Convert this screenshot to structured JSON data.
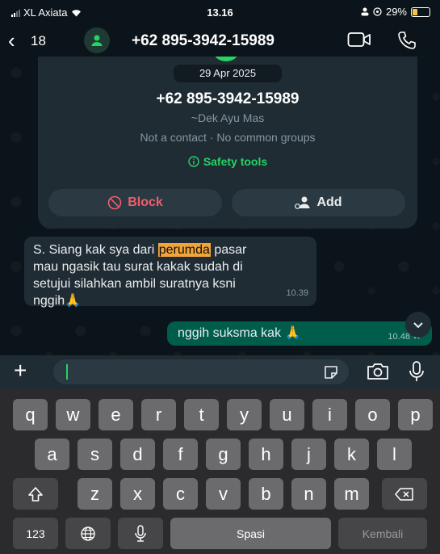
{
  "status_bar": {
    "carrier": "XL Axiata",
    "time": "13.16",
    "battery": "29%",
    "battery_level": 0.29
  },
  "header": {
    "back_count": "18",
    "contact_title": "+62 895-3942-15989"
  },
  "info_card": {
    "date": "29 Apr 2025",
    "phone": "+62 895-3942-15989",
    "push_name": "~Dek Ayu Mas",
    "subtitle": "Not a contact · No common groups",
    "safety_tools": "Safety tools",
    "block_label": "Block",
    "add_label": "Add"
  },
  "messages": {
    "incoming": {
      "line1_pre": "S. Siang kak sya dari ",
      "line1_highlight": "perumda",
      "line1_post": " pasar",
      "line2": "mau ngasik tau surat kakak sudah di",
      "line3": "setujui silahkan ambil suratnya ksni",
      "line4": "nggih🙏",
      "time": "10.39"
    },
    "outgoing": {
      "text": "nggih suksma kak 🙏",
      "time": "10.48"
    }
  },
  "keyboard": {
    "row1": [
      "q",
      "w",
      "e",
      "r",
      "t",
      "y",
      "u",
      "i",
      "o",
      "p"
    ],
    "row2": [
      "a",
      "s",
      "d",
      "f",
      "g",
      "h",
      "j",
      "k",
      "l"
    ],
    "row3": [
      "z",
      "x",
      "c",
      "v",
      "b",
      "n",
      "m"
    ],
    "numbers_key": "123",
    "space_key": "Spasi",
    "return_key": "Kembali"
  },
  "colors": {
    "accent": "#25d366",
    "outgoing_bubble": "#005c4b",
    "incoming_bubble": "#202c33",
    "danger": "#f15c6d"
  }
}
